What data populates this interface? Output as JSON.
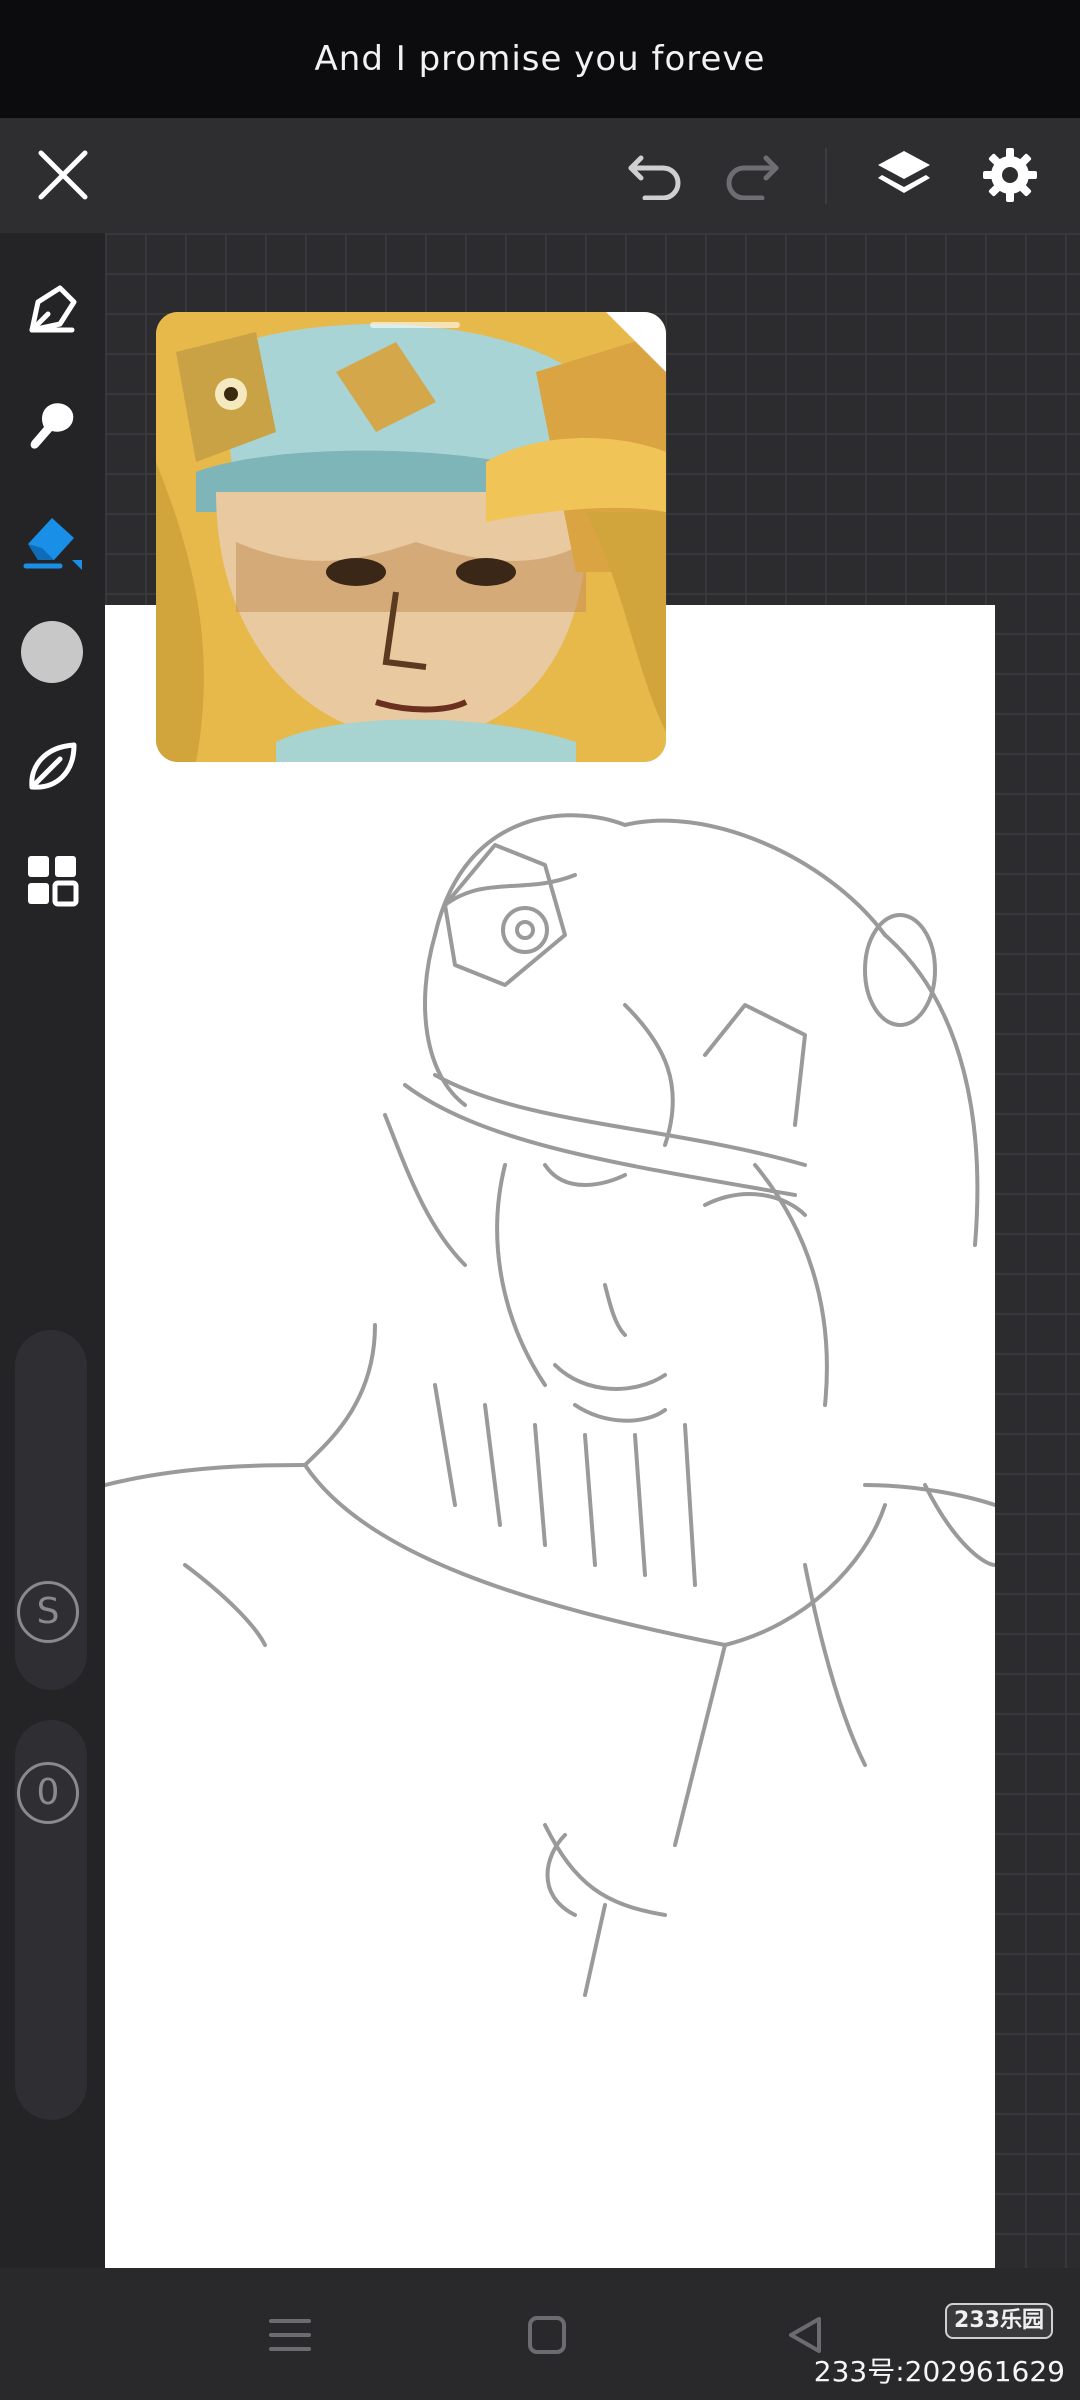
{
  "caption": {
    "text": "And I promise you foreve"
  },
  "toolbar": {
    "close_icon": "close-icon",
    "undo_icon": "undo-icon",
    "redo_icon": "redo-icon",
    "layers_icon": "layers-icon",
    "settings_icon": "gear-icon"
  },
  "sidebar": {
    "tools": [
      {
        "name": "pen-tool-icon",
        "active": false
      },
      {
        "name": "smudge-tool-icon",
        "active": false
      },
      {
        "name": "eraser-tool-icon",
        "active": true
      },
      {
        "name": "color-picker-icon",
        "active": false
      },
      {
        "name": "leaf-brush-icon",
        "active": false
      },
      {
        "name": "grid-menu-icon",
        "active": false
      }
    ],
    "size_label": "S",
    "opacity_label": "0",
    "active_color": "#1a8fe8",
    "current_color": "#c8c8c8"
  },
  "watermark": {
    "logo": "233乐园",
    "id_text": "233号:202961629"
  },
  "colors": {
    "background": "#2b2b2e",
    "accent": "#1a8fe8",
    "paper": "#ffffff",
    "sketch": "#9a9a9a"
  }
}
